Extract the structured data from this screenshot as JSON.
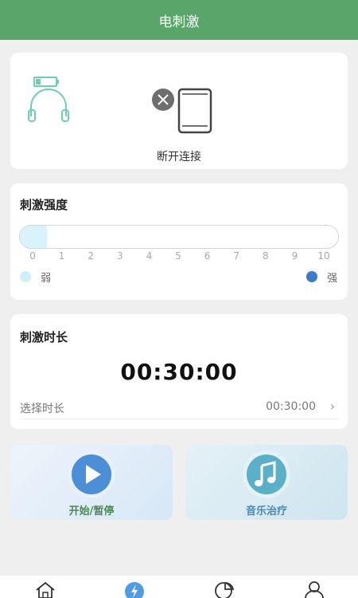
{
  "header": {
    "title": "电刺激"
  },
  "device": {
    "connection_status": "断开连接",
    "headset_icon": "headphones-icon",
    "battery_icon": "battery-icon",
    "phone_icon": "phone-icon",
    "disconnected_icon": "close-icon",
    "accent_color": "#6ccfb0"
  },
  "intensity": {
    "title": "刺激强度",
    "ticks": [
      "0",
      "1",
      "2",
      "3",
      "4",
      "5",
      "6",
      "7",
      "8",
      "9",
      "10"
    ],
    "current_value": 0.5,
    "max_value": 10,
    "weak_label": "弱",
    "strong_label": "强",
    "weak_color": "#cdeff9",
    "strong_color": "#3d7cc9"
  },
  "duration": {
    "title": "刺激时长",
    "timer": "00:30:00",
    "select_label": "选择时长",
    "select_value": "00:30:00",
    "arrow_icon": "chevron-right-icon"
  },
  "actions": {
    "start_label": "开始/暂停",
    "start_icon": "play-icon",
    "start_color": "#4d8fd6",
    "music_label": "音乐治疗",
    "music_icon": "music-note-icon",
    "music_color": "#5bb0c8"
  },
  "tabbar": {
    "items": [
      {
        "icon": "home-icon"
      },
      {
        "icon": "lightning-icon",
        "active": true
      },
      {
        "icon": "pie-chart-icon"
      },
      {
        "icon": "user-icon"
      }
    ],
    "active_color": "#4f9de0"
  }
}
